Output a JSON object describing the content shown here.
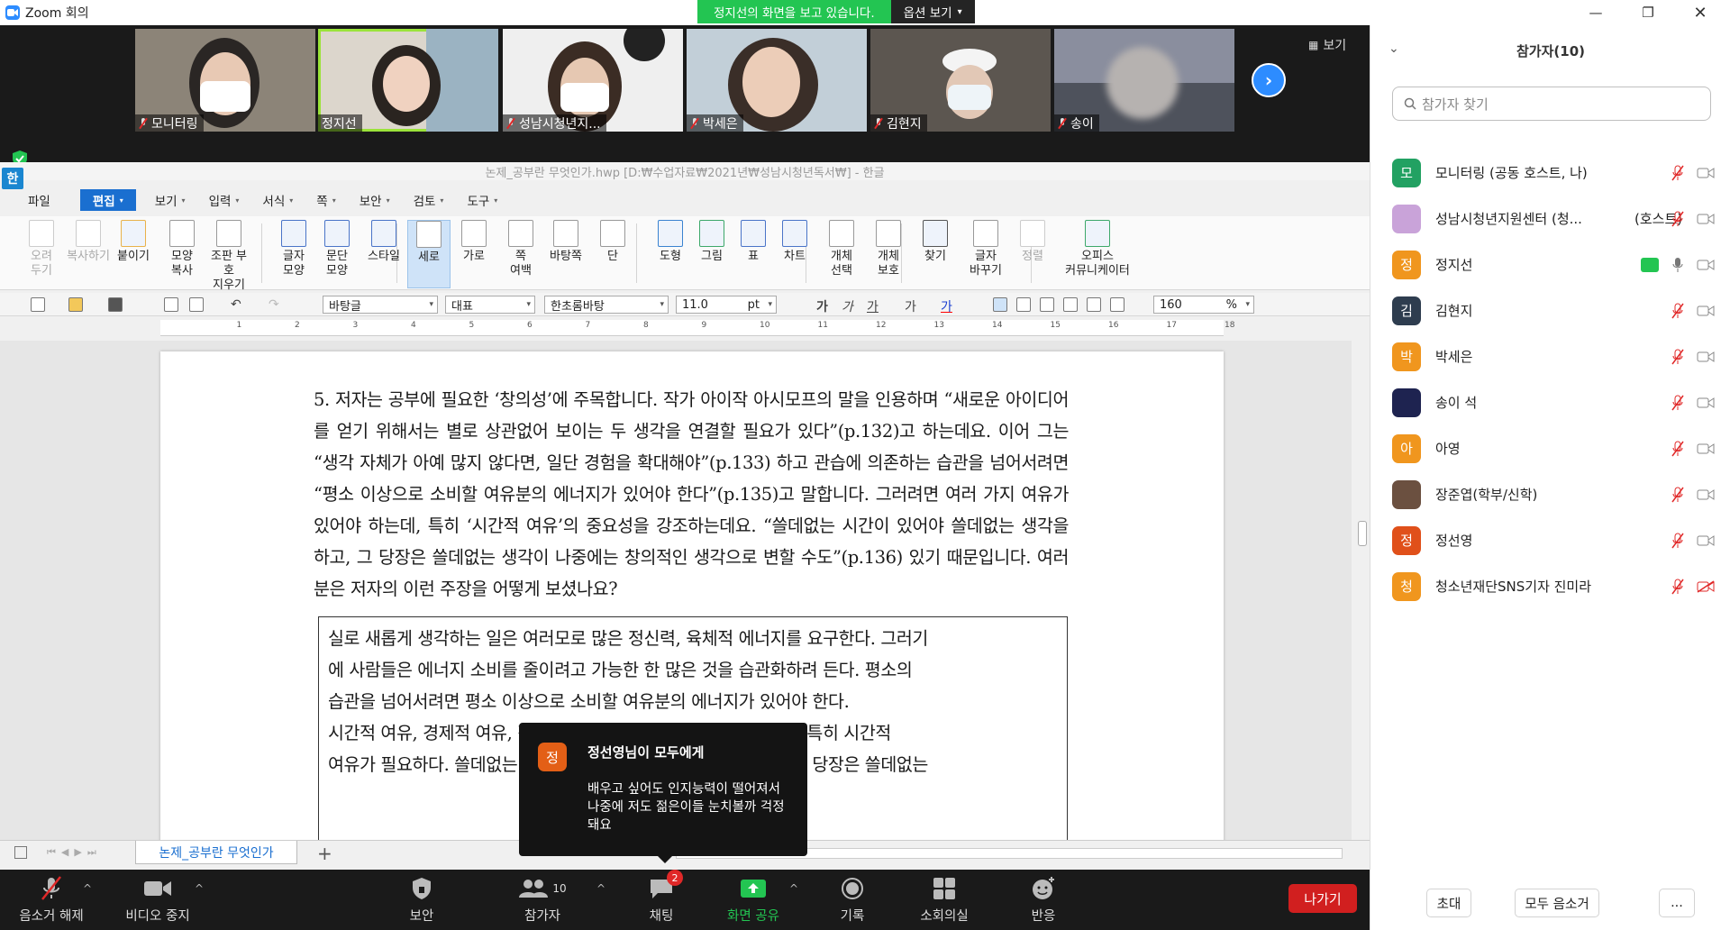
{
  "window": {
    "title": "Zoom 회의"
  },
  "banner": {
    "sharing_text": "정지선의 화면을 보고 있습니다.",
    "options_label": "옵션 보기"
  },
  "videos": [
    {
      "name": "모니터링"
    },
    {
      "name": "정지선"
    },
    {
      "name": "성남시청년지..."
    },
    {
      "name": "박세은"
    },
    {
      "name": "김현지"
    },
    {
      "name": "송이"
    }
  ],
  "view_label": "보기",
  "hwp": {
    "title": "논제_공부란 무엇인가.hwp [D:₩수업자료₩2021년₩성남시청년독서₩] - 한글",
    "logo": "한",
    "menus": [
      "파일",
      "편집",
      "보기",
      "입력",
      "서식",
      "쪽",
      "보안",
      "검토",
      "도구"
    ],
    "ribbon": [
      [
        "오려",
        "두기"
      ],
      [
        "복사하기",
        ""
      ],
      [
        "붙이기",
        ""
      ],
      [
        "모양",
        "복사"
      ],
      [
        "조판 부호",
        "지우기"
      ],
      [
        "글자",
        "모양"
      ],
      [
        "문단",
        "모양"
      ],
      [
        "스타일",
        ""
      ],
      [
        "세로",
        ""
      ],
      [
        "가로",
        ""
      ],
      [
        "쪽",
        "여백"
      ],
      [
        "바탕쪽",
        ""
      ],
      [
        "단",
        ""
      ],
      [
        "도형",
        ""
      ],
      [
        "그림",
        ""
      ],
      [
        "표",
        ""
      ],
      [
        "차트",
        ""
      ],
      [
        "개체",
        "선택"
      ],
      [
        "개체",
        "보호"
      ],
      [
        "찾기",
        ""
      ],
      [
        "글자",
        "바꾸기"
      ],
      [
        "정렬",
        ""
      ],
      [
        "오피스",
        "커뮤니케이터"
      ]
    ],
    "format": {
      "style": "바탕글",
      "lang": "대표",
      "font": "한초롬바탕",
      "size": "11.0",
      "unit": "pt",
      "zoom": "160",
      "zoom_unit": "%"
    },
    "paragraph": "5. 저자는 공부에 필요한 ‘창의성’에 주목합니다. 작가 아이작 아시모프의 말을 인용하며 “새로운 아이디어를 얻기 위해서는 별로 상관없어 보이는 두 생각을 연결할 필요가 있다”(p.132)고 하는데요. 이어 그는 “생각 자체가 아예 많지 않다면, 일단 경험을 확대해야”(p.133) 하고 관습에 의존하는 습관을 넘어서려면 “평소 이상으로 소비할 여유분의 에너지가 있어야 한다”(p.135)고 말합니다. 그러려면 여러 가지 여유가 있어야 하는데, 특히 ‘시간적 여유’의 중요성을 강조하는데요. “쓸데없는 시간이 있어야 쓸데없는 생각을 하고, 그 당장은 쓸데없는 생각이 나중에는 창의적인 생각으로 변할 수도”(p.136) 있기 때문입니다. 여러분은 저자의 이런 주장을 어떻게 보셨나요?",
    "quote": [
      "실로 새롭게 생각하는 일은 여러모로 많은 정신력, 육체적 에너지를 요구한다. 그러기",
      "에 사람들은 에너지 소비를 줄이려고 가능한 한 많은 것을 습관화하려 든다. 평소의",
      "습관을 넘어서려면 평소 이상으로 소비할 여유분의 에너지가 있어야 한다.",
      "시간적 여유, 경제적 여유, 정신적 여유 등 모든 여유가 필요하지만, 특히 시간적",
      "여유가 필요하다. 쓸데없는 시간이 있어야 쓸데없는 생각을 하고, 그 당장은 쓸데없는"
    ],
    "doc_tab": "논제_공부란 무엇인가"
  },
  "toast": {
    "avatar": "정",
    "from": "정선영님이 모두에게",
    "message": "배우고 싶어도 인지능력이 떨어져서 나중에 저도 젊은이들 눈치볼까 걱정돼요"
  },
  "controls": {
    "mute": "음소거 해제",
    "video": "비디오 중지",
    "security": "보안",
    "participants": "참가자",
    "participants_count": "10",
    "chat": "채팅",
    "chat_badge": "2",
    "share": "화면 공유",
    "record": "기록",
    "breakout": "소회의실",
    "reactions": "반응",
    "leave": "나가기"
  },
  "panel": {
    "title": "참가자(10)",
    "search_placeholder": "참가자 찾기",
    "participants": [
      {
        "avatar": "모",
        "color": "#22a162",
        "name": "모니터링 (공동 호스트, 나)",
        "role": ""
      },
      {
        "avatar": "",
        "color": "#c9a3d9",
        "name": "성남시청년지원센터 (청...",
        "role": "(호스트)"
      },
      {
        "avatar": "정",
        "color": "#f0961e",
        "name": "정지선",
        "role": ""
      },
      {
        "avatar": "김",
        "color": "#2e3d4f",
        "name": "김현지",
        "role": ""
      },
      {
        "avatar": "박",
        "color": "#f0961e",
        "name": "박세은",
        "role": ""
      },
      {
        "avatar": "",
        "color": "#1e2350",
        "name": "송이 석",
        "role": ""
      },
      {
        "avatar": "아",
        "color": "#f0961e",
        "name": "아영",
        "role": ""
      },
      {
        "avatar": "",
        "color": "#6b5040",
        "name": "장준엽(학부/신학)",
        "role": ""
      },
      {
        "avatar": "정",
        "color": "#e0501a",
        "name": "정선영",
        "role": ""
      },
      {
        "avatar": "청",
        "color": "#f0961e",
        "name": "청소년재단SNS기자 진미라",
        "role": ""
      }
    ],
    "invite": "초대",
    "mute_all": "모두 음소거",
    "more": "..."
  }
}
